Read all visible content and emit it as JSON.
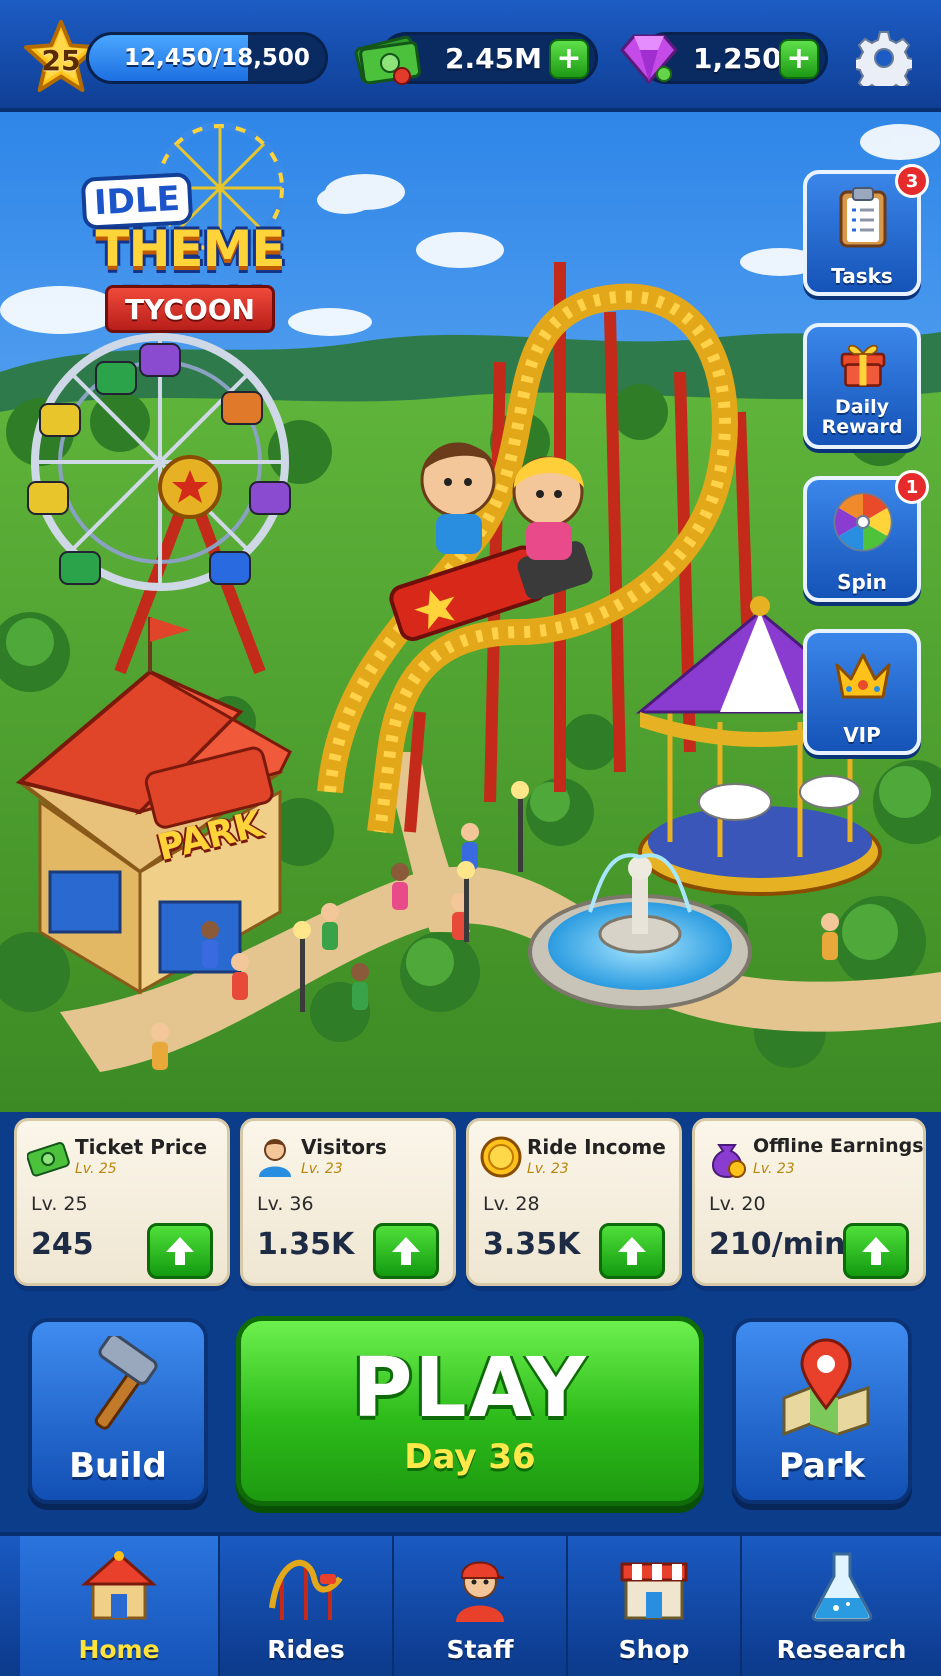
{
  "header": {
    "level": "25",
    "xp_text": "12,450/18,500",
    "xp_progress": 0.673,
    "cash": "2.45M",
    "gems": "1,250",
    "plus_symbol": "+"
  },
  "logo": {
    "line1": "IDLE",
    "line2": "THEME PARK",
    "line3": "TYCOON"
  },
  "park_sign": "PARK",
  "side_buttons": [
    {
      "label": "Tasks",
      "badge": "3",
      "icon": "clipboard-icon"
    },
    {
      "label": "Daily Reward",
      "badge": "",
      "icon": "gift-icon"
    },
    {
      "label": "Spin",
      "badge": "1",
      "icon": "spin-wheel-icon"
    },
    {
      "label": "VIP",
      "badge": "",
      "icon": "crown-icon"
    }
  ],
  "stat_cards": [
    {
      "title": "Ticket Price",
      "sub": "Lv. 25",
      "level": "Lv. 25",
      "value": "245",
      "icon": "cash-icon"
    },
    {
      "title": "Visitors",
      "sub": "Lv. 23",
      "level": "Lv. 36",
      "value": "1.35K",
      "icon": "visitor-icon"
    },
    {
      "title": "Ride Income",
      "sub": "Lv. 23",
      "level": "Lv. 28",
      "value": "3.35K",
      "icon": "coin-icon"
    },
    {
      "title": "Offline Earnings",
      "sub": "Lv. 23",
      "level": "Lv. 20",
      "value": "210/min",
      "icon": "money-bag-icon"
    }
  ],
  "actions": {
    "build_label": "Build",
    "play_label": "PLAY",
    "play_sub": "Day 36",
    "park_label": "Park"
  },
  "nav": [
    {
      "label": "Home",
      "icon": "home-icon",
      "active": true
    },
    {
      "label": "Rides",
      "icon": "roller-coaster-icon",
      "active": false
    },
    {
      "label": "Staff",
      "icon": "staff-icon",
      "active": false
    },
    {
      "label": "Shop",
      "icon": "shop-icon",
      "active": false
    },
    {
      "label": "Research",
      "icon": "flask-icon",
      "active": false
    }
  ],
  "colors": {
    "accent_green": "#2dbb1a",
    "primary_blue": "#1553b7",
    "gold": "#ffd33a"
  }
}
